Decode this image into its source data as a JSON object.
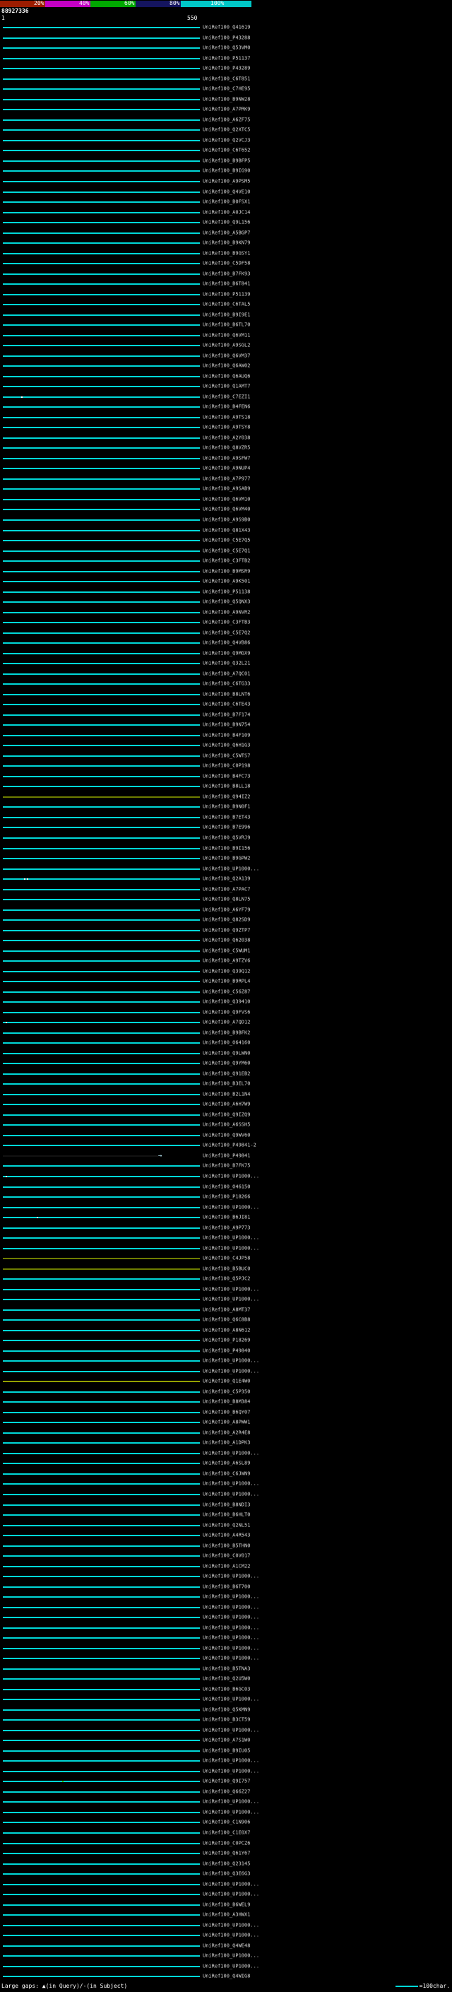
{
  "header": {
    "query_id": "88927336",
    "ruler_start": "1",
    "ruler_end": "550"
  },
  "footer": {
    "gaps_legend": "Large gaps: ▲(in Query)/-(in Subject)",
    "scale_legend": "=100char."
  },
  "chart_data": {
    "type": "bar",
    "subtype": "blast-hit-overview",
    "orientation": "horizontal",
    "title": "",
    "xlabel": "query position",
    "x_range": [
      1,
      550
    ],
    "query": {
      "id": "88927336",
      "length": 550
    },
    "identity_scale": {
      "labels": [
        "20%",
        "40%",
        "60%",
        "80%",
        "100%"
      ],
      "colors": [
        "#9c1c00",
        "#c400c4",
        "#00a800",
        "#14145e",
        "#00c8c8"
      ]
    },
    "colors": {
      "default": "#00d8d8",
      "olive": "#6e7d00",
      "olive_bright": "#93a000",
      "dark": "#121212"
    },
    "label_prefix": "UniRef100_",
    "arrow_glyph": "→",
    "hits": [
      {
        "label": "Q41619"
      },
      {
        "label": "P43288"
      },
      {
        "label": "Q53VM0"
      },
      {
        "label": "P51137"
      },
      {
        "label": "P43289"
      },
      {
        "label": "C6T851"
      },
      {
        "label": "C7HE95"
      },
      {
        "label": "B9NW28"
      },
      {
        "label": "A7PRK9"
      },
      {
        "label": "A6ZF75"
      },
      {
        "label": "Q2XTC5"
      },
      {
        "label": "Q2VCJ3"
      },
      {
        "label": "C6T652"
      },
      {
        "label": "B9BFP5"
      },
      {
        "label": "B9IG90"
      },
      {
        "label": "A9PSM5"
      },
      {
        "label": "Q4VE10"
      },
      {
        "label": "B0FSX1"
      },
      {
        "label": "A0JC14"
      },
      {
        "label": "Q9L156"
      },
      {
        "label": "A5BGP7"
      },
      {
        "label": "B9KN79"
      },
      {
        "label": "B9GSY1"
      },
      {
        "label": "C5DF58"
      },
      {
        "label": "B7FK93"
      },
      {
        "label": "B6T841"
      },
      {
        "label": "P51139"
      },
      {
        "label": "C6TAL5"
      },
      {
        "label": "B9I9E1"
      },
      {
        "label": "B6TL70"
      },
      {
        "label": "Q6VM11"
      },
      {
        "label": "A9SGL2"
      },
      {
        "label": "Q6VM37"
      },
      {
        "label": "Q6AW02"
      },
      {
        "label": "Q6AUQ6"
      },
      {
        "label": "Q1AMT7"
      },
      {
        "label": "C7EZI1",
        "marks": [
          30
        ]
      },
      {
        "label": "B4FEN6"
      },
      {
        "label": "A9TS18"
      },
      {
        "label": "A9TSY8"
      },
      {
        "label": "A2Y038"
      },
      {
        "label": "Q8VZR5"
      },
      {
        "label": "A9SFW7"
      },
      {
        "label": "A9NUP4"
      },
      {
        "label": "A7P977"
      },
      {
        "label": "A9SAB9"
      },
      {
        "label": "Q6VM10"
      },
      {
        "label": "Q6VM40"
      },
      {
        "label": "A9S9B0"
      },
      {
        "label": "Q81X43"
      },
      {
        "label": "C5E7Q5"
      },
      {
        "label": "C5E7Q1"
      },
      {
        "label": "C3FTB2"
      },
      {
        "label": "B9MSR9"
      },
      {
        "label": "A9K501"
      },
      {
        "label": "P51138"
      },
      {
        "label": "Q5QNX3"
      },
      {
        "label": "A9NVR2"
      },
      {
        "label": "C3FTB3"
      },
      {
        "label": "C5E7Q2"
      },
      {
        "label": "Q4VB86"
      },
      {
        "label": "Q9MGX9"
      },
      {
        "label": "Q32L21"
      },
      {
        "label": "A7QC01"
      },
      {
        "label": "C6TG33"
      },
      {
        "label": "B8LNT6"
      },
      {
        "label": "C6TE43"
      },
      {
        "label": "B7F174"
      },
      {
        "label": "B9N754"
      },
      {
        "label": "B4F109"
      },
      {
        "label": "Q6H1G3"
      },
      {
        "label": "C5WTS7"
      },
      {
        "label": "C0P198"
      },
      {
        "label": "B4FC73"
      },
      {
        "label": "B8LL18"
      },
      {
        "label": "Q94IZ2",
        "color": "olive"
      },
      {
        "label": "B9N0F1"
      },
      {
        "label": "B7ET43"
      },
      {
        "label": "B7E996"
      },
      {
        "label": "Q5VRJ9"
      },
      {
        "label": "B9I156"
      },
      {
        "label": "B9GPW2"
      },
      {
        "label": "UP1000..."
      },
      {
        "label": "Q2A139",
        "marks": [
          34,
          38
        ]
      },
      {
        "label": "A7PAC7"
      },
      {
        "label": "Q8LN75"
      },
      {
        "label": "A6YF79"
      },
      {
        "label": "Q82SD9"
      },
      {
        "label": "Q9ZTP7"
      },
      {
        "label": "Q62038"
      },
      {
        "label": "C5WUM1"
      },
      {
        "label": "A9TZV6"
      },
      {
        "label": "Q39Q12"
      },
      {
        "label": "B9RPL4"
      },
      {
        "label": "C56Z87"
      },
      {
        "label": "Q39410"
      },
      {
        "label": "Q9FVS6"
      },
      {
        "label": "A7QD12",
        "marks": [
          8
        ]
      },
      {
        "label": "B9BFK2"
      },
      {
        "label": "O64160"
      },
      {
        "label": "Q9LWN0"
      },
      {
        "label": "Q9YM60"
      },
      {
        "label": "Q91EB2"
      },
      {
        "label": "B3EL70"
      },
      {
        "label": "B2L1N4"
      },
      {
        "label": "A6H7W9"
      },
      {
        "label": "Q9IZQ9"
      },
      {
        "label": "A6SSH5"
      },
      {
        "label": "Q9WV60"
      },
      {
        "label": "P49841-2"
      },
      {
        "label": "P49841",
        "arrow": true
      },
      {
        "label": "B7FK75"
      },
      {
        "label": "UP1000...",
        "marks": [
          8
        ]
      },
      {
        "label": "O46150"
      },
      {
        "label": "P18266"
      },
      {
        "label": "UP1000..."
      },
      {
        "label": "B6JI81",
        "marks": [
          52
        ]
      },
      {
        "label": "A9P773"
      },
      {
        "label": "UP1000..."
      },
      {
        "label": "UP1000..."
      },
      {
        "label": "C4JP58",
        "color": "olive"
      },
      {
        "label": "B5BUC0",
        "color": "olive"
      },
      {
        "label": "Q5PJC2"
      },
      {
        "label": "UP1000..."
      },
      {
        "label": "UP1000..."
      },
      {
        "label": "A8MT37"
      },
      {
        "label": "Q6C8B8"
      },
      {
        "label": "A8N612"
      },
      {
        "label": "P18269"
      },
      {
        "label": "P49840"
      },
      {
        "label": "UP1000..."
      },
      {
        "label": "UP1000..."
      },
      {
        "label": "Q1E4W0",
        "color": "olive_bright"
      },
      {
        "label": "C5P350"
      },
      {
        "label": "B8M384"
      },
      {
        "label": "B6QY07"
      },
      {
        "label": "A8PWW1"
      },
      {
        "label": "A2R4E8"
      },
      {
        "label": "A1DPK3"
      },
      {
        "label": "UP1000..."
      },
      {
        "label": "A6SL89"
      },
      {
        "label": "C6JWN9"
      },
      {
        "label": "UP1000..."
      },
      {
        "label": "UP1000..."
      },
      {
        "label": "B8NDI3"
      },
      {
        "label": "B6HLT0"
      },
      {
        "label": "Q2NL51"
      },
      {
        "label": "A4R543"
      },
      {
        "label": "B5THN0"
      },
      {
        "label": "C0V017"
      },
      {
        "label": "A1CM22"
      },
      {
        "label": "UP1000..."
      },
      {
        "label": "B6T700"
      },
      {
        "label": "UP1000..."
      },
      {
        "label": "UP1000..."
      },
      {
        "label": "UP1000..."
      },
      {
        "label": "UP1000..."
      },
      {
        "label": "UP1000..."
      },
      {
        "label": "UP1000..."
      },
      {
        "label": "UP1000..."
      },
      {
        "label": "B5TNA3"
      },
      {
        "label": "Q2U5W0"
      },
      {
        "label": "B6GC03"
      },
      {
        "label": "UP1000..."
      },
      {
        "label": "Q5KMN9"
      },
      {
        "label": "B3CT59"
      },
      {
        "label": "UP1000..."
      },
      {
        "label": "A7S1W0"
      },
      {
        "label": "B9IU05"
      },
      {
        "label": "UP1000..."
      },
      {
        "label": "UP1000..."
      },
      {
        "label": "Q9I757",
        "marks": [
          88
        ],
        "mcolor": "#35c400"
      },
      {
        "label": "Q66Z27"
      },
      {
        "label": "UP1000..."
      },
      {
        "label": "UP1000..."
      },
      {
        "label": "C1N906"
      },
      {
        "label": "C1E0X7"
      },
      {
        "label": "C0PCZ6"
      },
      {
        "label": "Q61Y67"
      },
      {
        "label": "Q23145"
      },
      {
        "label": "Q3E6G3"
      },
      {
        "label": "UP1000..."
      },
      {
        "label": "UP1000..."
      },
      {
        "label": "B6WEL9"
      },
      {
        "label": "A3HWX1"
      },
      {
        "label": "UP1000..."
      },
      {
        "label": "UP1000..."
      },
      {
        "label": "Q4WE48"
      },
      {
        "label": "UP1000..."
      },
      {
        "label": "UP1000..."
      },
      {
        "label": "Q4WIG8"
      }
    ]
  }
}
